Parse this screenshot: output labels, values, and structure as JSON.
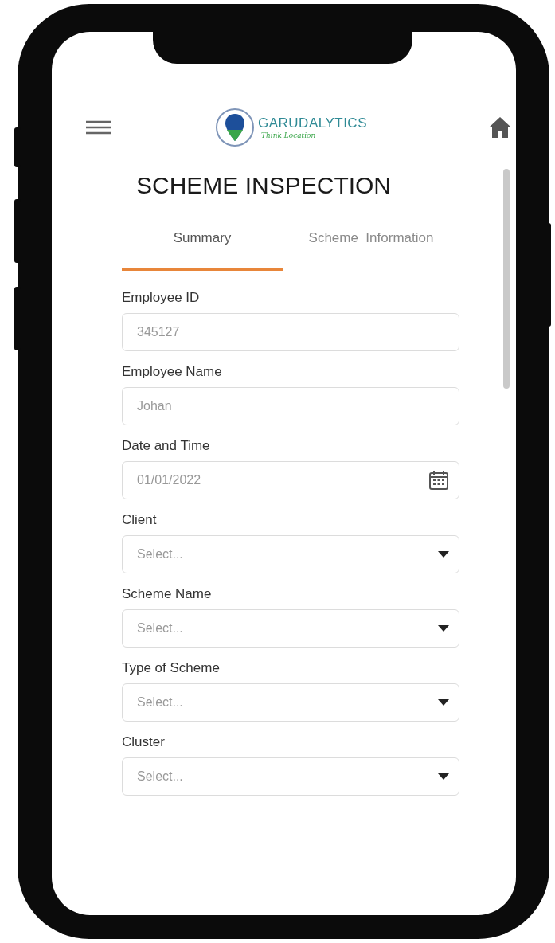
{
  "header": {
    "logo": {
      "name": "GARUDALYTICS",
      "tagline": "Think Location"
    }
  },
  "title": "SCHEME INSPECTION",
  "tabs": [
    {
      "label": "Summary",
      "selected": true
    },
    {
      "label": "Scheme  Information",
      "selected": false
    }
  ],
  "fields": [
    {
      "kind": "text",
      "label": "Employee ID",
      "value": "345127"
    },
    {
      "kind": "text",
      "label": "Employee Name",
      "value": "Johan"
    },
    {
      "kind": "date",
      "label": "Date and Time",
      "value": "01/01/2022"
    },
    {
      "kind": "select",
      "label": "Client",
      "placeholder": "Select..."
    },
    {
      "kind": "select",
      "label": "Scheme Name",
      "placeholder": "Select..."
    },
    {
      "kind": "select",
      "label": "Type of Scheme",
      "placeholder": "Select..."
    },
    {
      "kind": "select",
      "label": "Cluster",
      "placeholder": "Select..."
    }
  ]
}
